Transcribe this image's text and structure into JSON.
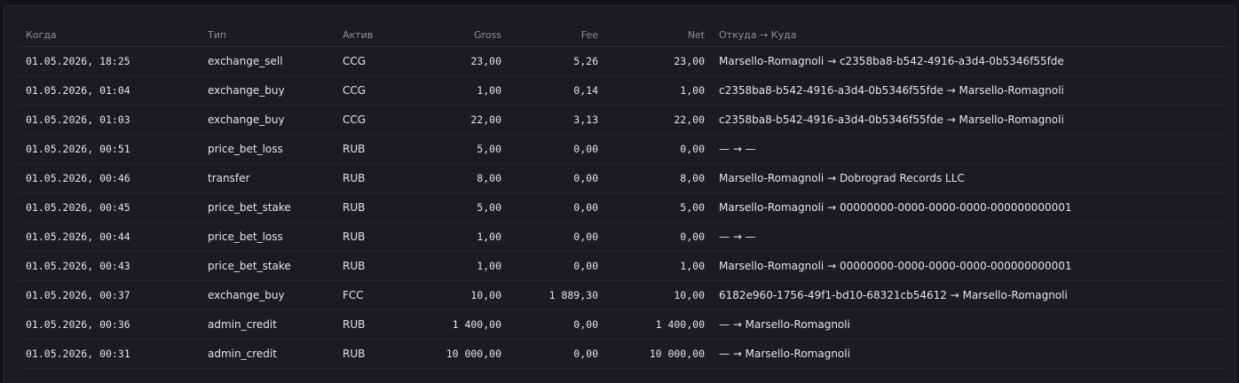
{
  "table": {
    "headers": [
      "Когда",
      "Тип",
      "Актив",
      "Gross",
      "Fee",
      "Net",
      "Откуда → Куда"
    ],
    "rows": [
      {
        "when": "01.05.2026, 18:25",
        "type": "exchange_sell",
        "asset": "CCG",
        "gross": "23,00",
        "fee": "5,26",
        "net": "23,00",
        "route": "Marsello-Romagnoli → c2358ba8-b542-4916-a3d4-0b5346f55fde"
      },
      {
        "when": "01.05.2026, 01:04",
        "type": "exchange_buy",
        "asset": "CCG",
        "gross": "1,00",
        "fee": "0,14",
        "net": "1,00",
        "route": "c2358ba8-b542-4916-a3d4-0b5346f55fde → Marsello-Romagnoli"
      },
      {
        "when": "01.05.2026, 01:03",
        "type": "exchange_buy",
        "asset": "CCG",
        "gross": "22,00",
        "fee": "3,13",
        "net": "22,00",
        "route": "c2358ba8-b542-4916-a3d4-0b5346f55fde → Marsello-Romagnoli"
      },
      {
        "when": "01.05.2026, 00:51",
        "type": "price_bet_loss",
        "asset": "RUB",
        "gross": "5,00",
        "fee": "0,00",
        "net": "0,00",
        "route": "— → —"
      },
      {
        "when": "01.05.2026, 00:46",
        "type": "transfer",
        "asset": "RUB",
        "gross": "8,00",
        "fee": "0,00",
        "net": "8,00",
        "route": "Marsello-Romagnoli → Dobrograd Records LLC"
      },
      {
        "when": "01.05.2026, 00:45",
        "type": "price_bet_stake",
        "asset": "RUB",
        "gross": "5,00",
        "fee": "0,00",
        "net": "5,00",
        "route": "Marsello-Romagnoli → 00000000-0000-0000-0000-000000000001"
      },
      {
        "when": "01.05.2026, 00:44",
        "type": "price_bet_loss",
        "asset": "RUB",
        "gross": "1,00",
        "fee": "0,00",
        "net": "0,00",
        "route": "— → —"
      },
      {
        "when": "01.05.2026, 00:43",
        "type": "price_bet_stake",
        "asset": "RUB",
        "gross": "1,00",
        "fee": "0,00",
        "net": "1,00",
        "route": "Marsello-Romagnoli → 00000000-0000-0000-0000-000000000001"
      },
      {
        "when": "01.05.2026, 00:37",
        "type": "exchange_buy",
        "asset": "FCC",
        "gross": "10,00",
        "fee": "1 889,30",
        "net": "10,00",
        "route": "6182e960-1756-49f1-bd10-68321cb54612 → Marsello-Romagnoli"
      },
      {
        "when": "01.05.2026, 00:36",
        "type": "admin_credit",
        "asset": "RUB",
        "gross": "1 400,00",
        "fee": "0,00",
        "net": "1 400,00",
        "route": "— → Marsello-Romagnoli"
      },
      {
        "when": "01.05.2026, 00:31",
        "type": "admin_credit",
        "asset": "RUB",
        "gross": "10 000,00",
        "fee": "0,00",
        "net": "10 000,00",
        "route": "— → Marsello-Romagnoli"
      }
    ]
  }
}
